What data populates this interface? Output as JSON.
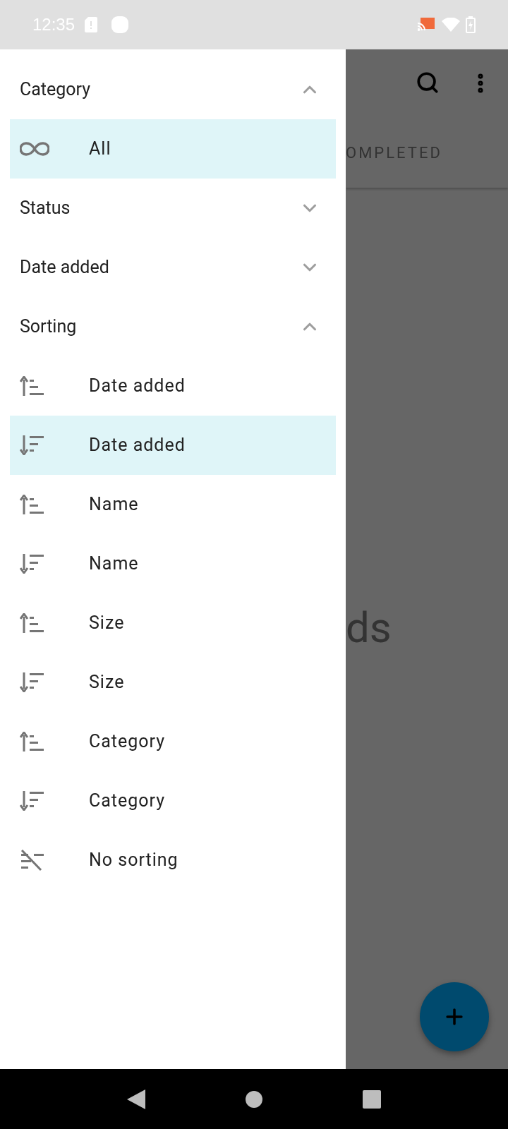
{
  "status_bar": {
    "time": "12:35"
  },
  "background": {
    "tab_label": "OMPLETED",
    "empty_text": "ds"
  },
  "drawer": {
    "sections": [
      {
        "title": "Category",
        "expanded": true,
        "items": [
          {
            "kind": "all",
            "label": "All",
            "selected": true
          }
        ]
      },
      {
        "title": "Status",
        "expanded": false
      },
      {
        "title": "Date added",
        "expanded": false
      },
      {
        "title": "Sorting",
        "expanded": true,
        "items": [
          {
            "kind": "ascending",
            "label": "Date added",
            "selected": false
          },
          {
            "kind": "descending",
            "label": "Date added",
            "selected": true
          },
          {
            "kind": "ascending",
            "label": "Name",
            "selected": false
          },
          {
            "kind": "descending",
            "label": "Name",
            "selected": false
          },
          {
            "kind": "ascending",
            "label": "Size",
            "selected": false
          },
          {
            "kind": "descending",
            "label": "Size",
            "selected": false
          },
          {
            "kind": "ascending",
            "label": "Category",
            "selected": false
          },
          {
            "kind": "descending",
            "label": "Category",
            "selected": false
          },
          {
            "kind": "none",
            "label": "No sorting",
            "selected": false
          }
        ]
      }
    ]
  }
}
